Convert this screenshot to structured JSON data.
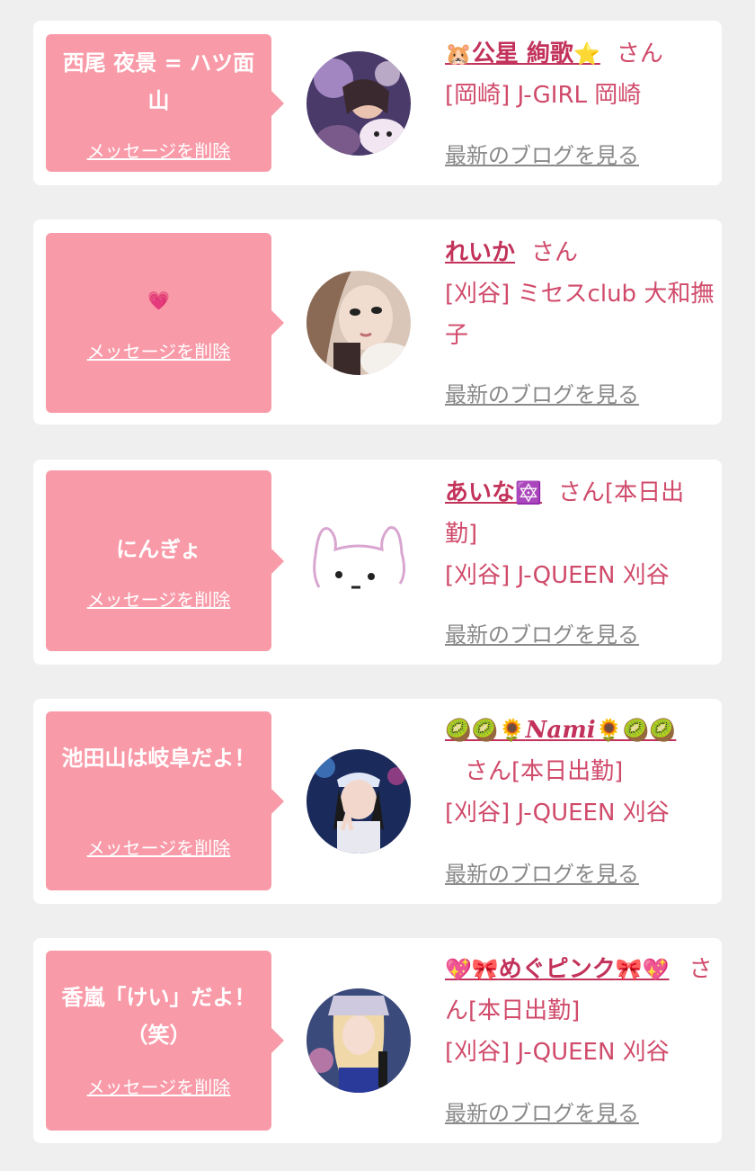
{
  "delete_label": "メッセージを削除",
  "san_label": "さん",
  "blog_label": "最新のブログを見る",
  "entries": [
    {
      "message": "西尾 夜景 = ハツ面山",
      "name_prefix_icon": "hamster-icon",
      "name": "公星 絢歌",
      "name_suffix_icon": "star-icon",
      "status": "",
      "store": "[岡崎] J-GIRL 岡崎"
    },
    {
      "message": "💗",
      "name_prefix_icon": "",
      "name": "れいか",
      "name_suffix_icon": "",
      "status": "",
      "store": "[刈谷] ミセスclub 大和撫子"
    },
    {
      "message": "にんぎょ",
      "name_prefix_icon": "",
      "name": "あいな",
      "name_suffix_icon": "star-of-david-icon",
      "status": "[本日出勤]",
      "store": "[刈谷] J-QUEEN 刈谷"
    },
    {
      "message": "池田山は岐阜だよ！",
      "name_prefix_icon": "kiwi-sunflower-icons",
      "name": "Nami",
      "name_suffix_icon": "sunflower-kiwi-icons",
      "status": "[本日出勤]",
      "store": "[刈谷] J-QUEEN 刈谷"
    },
    {
      "message": "香嵐「けい」だよ！（笑）",
      "name_prefix_icon": "sparkling-heart-ribbon-icons",
      "name": "めぐピンク",
      "name_suffix_icon": "ribbon-sparkling-heart-icons",
      "status": "[本日出勤]",
      "store": "[刈谷] J-QUEEN 刈谷"
    }
  ]
}
